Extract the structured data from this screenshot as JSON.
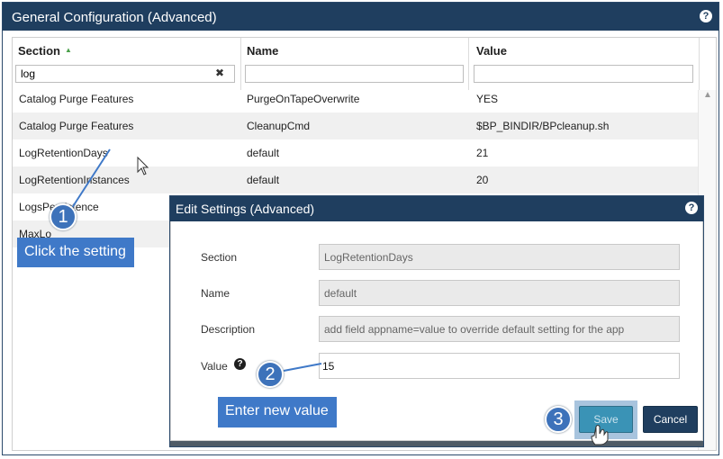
{
  "window": {
    "title": "General Configuration (Advanced)",
    "help_glyph": "?"
  },
  "grid": {
    "columns": [
      {
        "label": "Section",
        "sort_glyph": "▲"
      },
      {
        "label": "Name"
      },
      {
        "label": "Value"
      }
    ],
    "filters": {
      "section_value": "log",
      "name_value": "",
      "value_value": "",
      "clear_glyph": "✖"
    },
    "rows": [
      {
        "section": "Catalog Purge Features",
        "name": "PurgeOnTapeOverwrite",
        "value": "YES"
      },
      {
        "section": "Catalog Purge Features",
        "name": "CleanupCmd",
        "value": "$BP_BINDIR/BPcleanup.sh"
      },
      {
        "section": "LogRetentionDays",
        "name": "default",
        "value": "21"
      },
      {
        "section": "LogRetentionInstances",
        "name": "default",
        "value": "20"
      },
      {
        "section": "LogsPersistence",
        "name": "",
        "value": ""
      },
      {
        "section": "MaxLo",
        "name": "",
        "value": ""
      }
    ],
    "scroll_up_glyph": "▲"
  },
  "modal": {
    "title": "Edit Settings (Advanced)",
    "help_glyph": "?",
    "fields": {
      "section_label": "Section",
      "section_value": "LogRetentionDays",
      "name_label": "Name",
      "name_value": "default",
      "description_label": "Description",
      "description_value": "add field appname=value to override default setting for the app",
      "value_label": "Value",
      "value_value": "15",
      "value_help_glyph": "?"
    },
    "buttons": {
      "save": "Save",
      "cancel": "Cancel"
    }
  },
  "callouts": {
    "step1_number": "1",
    "step1_text": "Click the setting",
    "step2_number": "2",
    "step2_text": "Enter new value",
    "step3_number": "3"
  },
  "colors": {
    "title_bar": "#1f3e5f",
    "callout": "#3f79c8",
    "save_button": "#3a93b6",
    "save_highlight": "#a8c4de"
  }
}
